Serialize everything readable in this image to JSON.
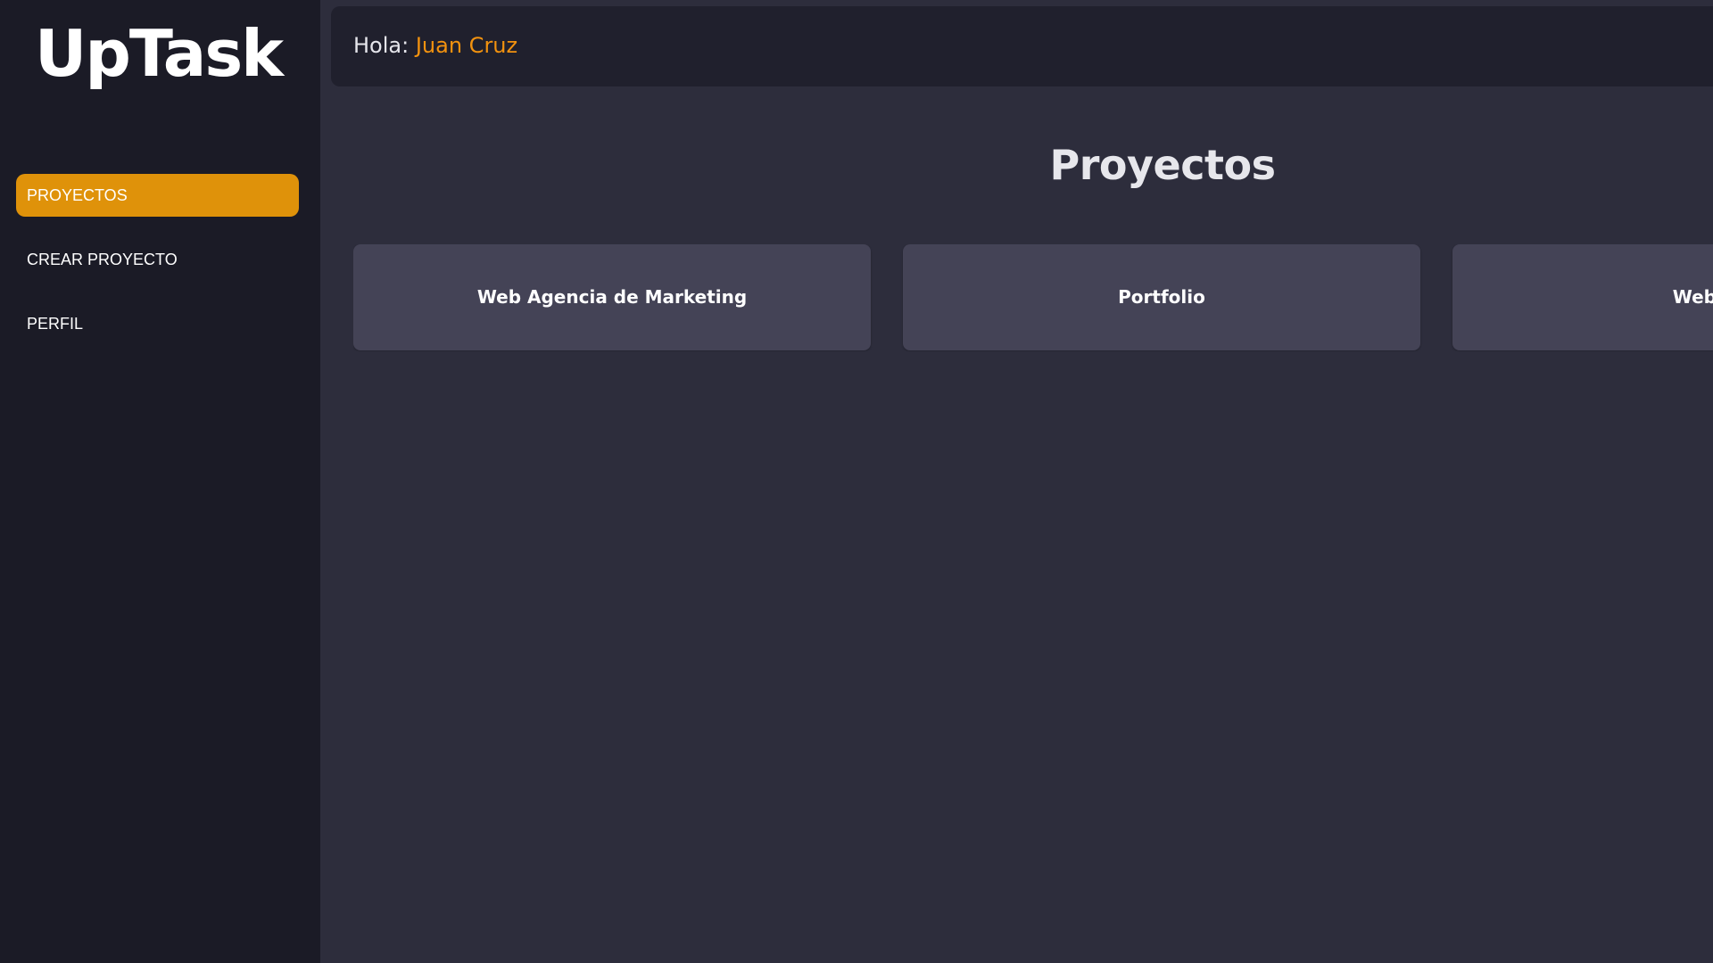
{
  "app": {
    "logo": "UpTask"
  },
  "sidebar": {
    "items": [
      {
        "label": "PROYECTOS",
        "active": true
      },
      {
        "label": "CREAR PROYECTO",
        "active": false
      },
      {
        "label": "PERFIL",
        "active": false
      }
    ]
  },
  "header": {
    "greeting_prefix": "Hola:",
    "user_name": "Juan Cruz"
  },
  "main": {
    "title": "Proyectos",
    "projects": [
      {
        "name": "Web Agencia de Marketing"
      },
      {
        "name": "Portfolio"
      },
      {
        "name": "Web He"
      }
    ]
  },
  "colors": {
    "accent": "#df920a",
    "username": "#f2920f",
    "sidebar_bg": "#1b1b26",
    "header_bg": "#20202d",
    "main_bg": "#2d2d3c",
    "card_bg": "#444356"
  }
}
